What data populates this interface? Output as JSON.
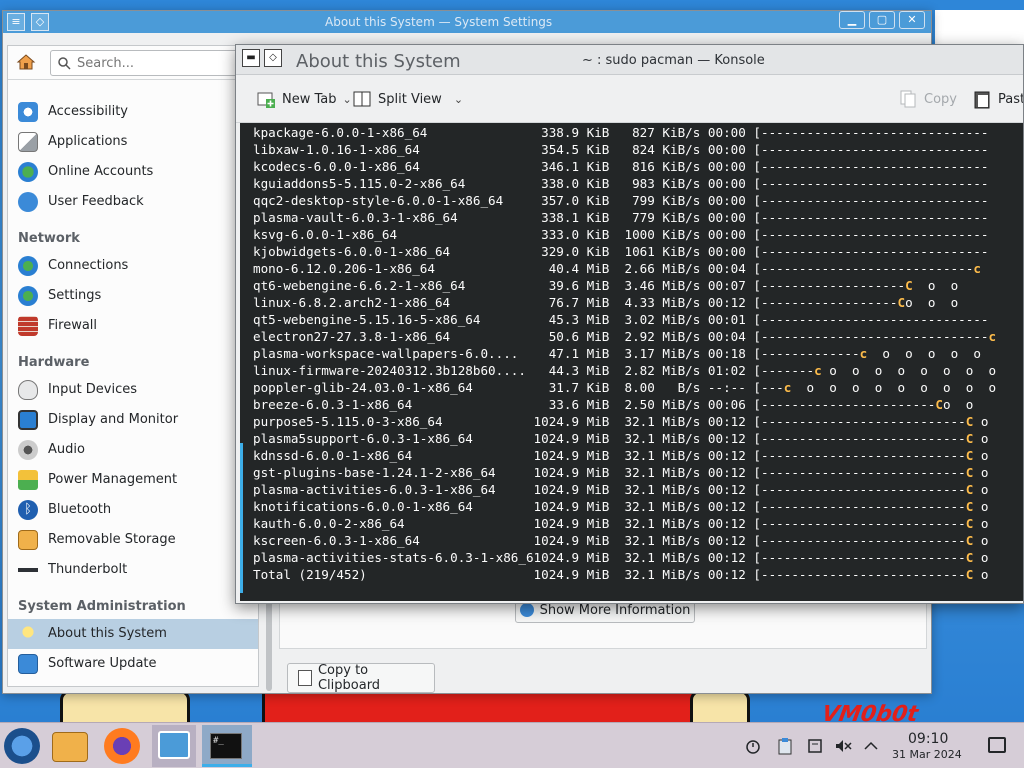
{
  "settings_window": {
    "title": "About this System — System Settings",
    "search_placeholder": "Search...",
    "sections": {
      "network": "Network",
      "hardware": "Hardware",
      "system_admin": "System Administration"
    },
    "items": {
      "accessibility": "Accessibility",
      "applications": "Applications",
      "online_accounts": "Online Accounts",
      "user_feedback": "User Feedback",
      "connections": "Connections",
      "settings": "Settings",
      "firewall": "Firewall",
      "input_devices": "Input Devices",
      "display_monitor": "Display and Monitor",
      "audio": "Audio",
      "power_management": "Power Management",
      "bluetooth": "Bluetooth",
      "removable_storage": "Removable Storage",
      "thunderbolt": "Thunderbolt",
      "about_system": "About this System",
      "software_update": "Software Update"
    },
    "show_more_label": "Show More Information",
    "copy_clipboard_label": "Copy to Clipboard"
  },
  "konsole": {
    "overlay_title": "About this System",
    "title": "~ : sudo pacman — Konsole",
    "toolbar": {
      "new_tab": "New Tab",
      "split_view": "Split View",
      "copy": "Copy",
      "paste": "Paste"
    },
    "lines": [
      {
        "name": "kpackage-6.0.0-1-x86_64",
        "size": "338.9 KiB",
        "rate": " 827 KiB/s",
        "eta": "00:00",
        "bar": "[------------------------------",
        "pac": ""
      },
      {
        "name": "libxaw-1.0.16-1-x86_64",
        "size": "354.5 KiB",
        "rate": " 824 KiB/s",
        "eta": "00:00",
        "bar": "[------------------------------",
        "pac": ""
      },
      {
        "name": "kcodecs-6.0.0-1-x86_64",
        "size": "346.1 KiB",
        "rate": " 816 KiB/s",
        "eta": "00:00",
        "bar": "[------------------------------",
        "pac": ""
      },
      {
        "name": "kguiaddons5-5.115.0-2-x86_64",
        "size": "338.0 KiB",
        "rate": " 983 KiB/s",
        "eta": "00:00",
        "bar": "[------------------------------",
        "pac": ""
      },
      {
        "name": "qqc2-desktop-style-6.0.0-1-x86_64",
        "size": "357.0 KiB",
        "rate": " 799 KiB/s",
        "eta": "00:00",
        "bar": "[------------------------------",
        "pac": ""
      },
      {
        "name": "plasma-vault-6.0.3-1-x86_64",
        "size": "338.1 KiB",
        "rate": " 779 KiB/s",
        "eta": "00:00",
        "bar": "[------------------------------",
        "pac": ""
      },
      {
        "name": "ksvg-6.0.0-1-x86_64",
        "size": "333.0 KiB",
        "rate": "1000 KiB/s",
        "eta": "00:00",
        "bar": "[------------------------------",
        "pac": ""
      },
      {
        "name": "kjobwidgets-6.0.0-1-x86_64",
        "size": "329.0 KiB",
        "rate": "1061 KiB/s",
        "eta": "00:00",
        "bar": "[------------------------------",
        "pac": ""
      },
      {
        "name": "mono-6.12.0.206-1-x86_64",
        "size": " 40.4 MiB",
        "rate": "2.66 MiB/s",
        "eta": "00:04",
        "bar": "[----------------------------",
        "pac": "c"
      },
      {
        "name": "qt6-webengine-6.6.2-1-x86_64",
        "size": " 39.6 MiB",
        "rate": "3.46 MiB/s",
        "eta": "00:07",
        "bar": "[-------------------",
        "pac": "C",
        "tail": "  o  o"
      },
      {
        "name": "linux-6.8.2.arch2-1-x86_64",
        "size": " 76.7 MiB",
        "rate": "4.33 MiB/s",
        "eta": "00:12",
        "bar": "[------------------",
        "pac": "C",
        "tail": "o  o  o"
      },
      {
        "name": "qt5-webengine-5.15.16-5-x86_64",
        "size": " 45.3 MiB",
        "rate": "3.02 MiB/s",
        "eta": "00:01",
        "bar": "[------------------------------",
        "pac": ""
      },
      {
        "name": "electron27-27.3.8-1-x86_64",
        "size": " 50.6 MiB",
        "rate": "2.92 MiB/s",
        "eta": "00:04",
        "bar": "[------------------------------",
        "pac": "c"
      },
      {
        "name": "plasma-workspace-wallpapers-6.0....",
        "size": " 47.1 MiB",
        "rate": "3.17 MiB/s",
        "eta": "00:18",
        "bar": "[-------------",
        "pac": "c",
        "tail": "  o  o  o  o  o"
      },
      {
        "name": "linux-firmware-20240312.3b128b60....",
        "size": " 44.3 MiB",
        "rate": "2.82 MiB/s",
        "eta": "01:02",
        "bar": "[-------",
        "pac": "c",
        "tail": " o  o  o  o  o  o  o  o"
      },
      {
        "name": "poppler-glib-24.03.0-1-x86_64",
        "size": " 31.7 KiB",
        "rate": "8.00   B/s",
        "eta": "--:--",
        "bar": "[---",
        "pac": "c",
        "tail": "  o  o  o  o  o  o  o  o  o"
      },
      {
        "name": "breeze-6.0.3-1-x86_64",
        "size": " 33.6 MiB",
        "rate": "2.50 MiB/s",
        "eta": "00:06",
        "bar": "[-----------------------",
        "pac": "C",
        "tail": "o  o"
      },
      {
        "name": "purpose5-5.115.0-3-x86_64",
        "size": "1024.9 MiB",
        "rate": "32.1 MiB/s",
        "eta": "00:12",
        "bar": "[---------------------------",
        "pac": "C",
        "tail": " o"
      },
      {
        "name": "plasma5support-6.0.3-1-x86_64",
        "size": "1024.9 MiB",
        "rate": "32.1 MiB/s",
        "eta": "00:12",
        "bar": "[---------------------------",
        "pac": "C",
        "tail": " o"
      },
      {
        "name": "kdnssd-6.0.0-1-x86_64",
        "size": "1024.9 MiB",
        "rate": "32.1 MiB/s",
        "eta": "00:12",
        "bar": "[---------------------------",
        "pac": "C",
        "tail": " o"
      },
      {
        "name": "gst-plugins-base-1.24.1-2-x86_64",
        "size": "1024.9 MiB",
        "rate": "32.1 MiB/s",
        "eta": "00:12",
        "bar": "[---------------------------",
        "pac": "C",
        "tail": " o"
      },
      {
        "name": "plasma-activities-6.0.3-1-x86_64",
        "size": "1024.9 MiB",
        "rate": "32.1 MiB/s",
        "eta": "00:12",
        "bar": "[---------------------------",
        "pac": "C",
        "tail": " o"
      },
      {
        "name": "knotifications-6.0.0-1-x86_64",
        "size": "1024.9 MiB",
        "rate": "32.1 MiB/s",
        "eta": "00:12",
        "bar": "[---------------------------",
        "pac": "C",
        "tail": " o"
      },
      {
        "name": "kauth-6.0.0-2-x86_64",
        "size": "1024.9 MiB",
        "rate": "32.1 MiB/s",
        "eta": "00:12",
        "bar": "[---------------------------",
        "pac": "C",
        "tail": " o"
      },
      {
        "name": "kscreen-6.0.3-1-x86_64",
        "size": "1024.9 MiB",
        "rate": "32.1 MiB/s",
        "eta": "00:12",
        "bar": "[---------------------------",
        "pac": "C",
        "tail": " o"
      },
      {
        "name": "plasma-activities-stats-6.0.3-1-x86_64",
        "size": "1024.9 MiB",
        "rate": "32.1 MiB/s",
        "eta": "00:12",
        "bar": "[---------------------------",
        "pac": "C",
        "tail": " o"
      },
      {
        "name": "Total (219/452)",
        "size": "1024.9 MiB",
        "rate": "32.1 MiB/s",
        "eta": "00:12",
        "bar": "[---------------------------",
        "pac": "C",
        "tail": " o"
      }
    ]
  },
  "taskbar": {
    "time": "09:10",
    "date": "31 Mar 2024"
  },
  "wallpaper": {
    "logo_text": "VM0b0t"
  },
  "colors": {
    "accent": "#3daee9",
    "terminal_bg": "#232627",
    "pacman_yellow": "#fdbc4b",
    "selected_item": "#b8cfe2"
  }
}
